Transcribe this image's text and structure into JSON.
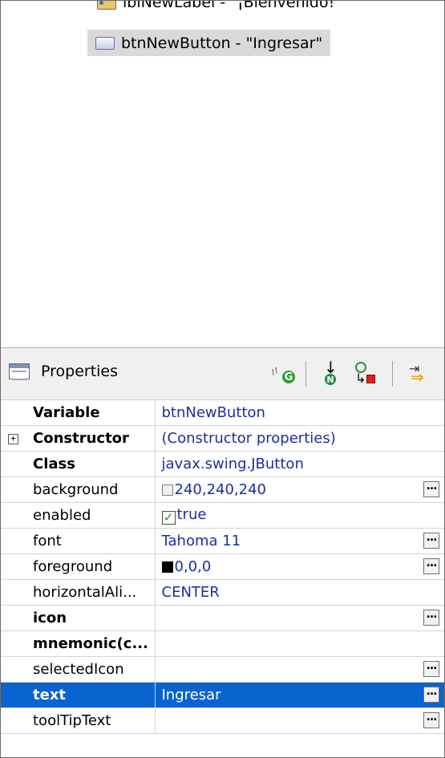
{
  "tree": {
    "items": [
      {
        "label": "lblNewLabel - \"¡Bienvenido!\"",
        "icon": "label-icon"
      },
      {
        "label": "btnNewButton - \"Ingresar\"",
        "icon": "button-icon",
        "selected": true
      }
    ]
  },
  "properties": {
    "title": "Properties",
    "toolbar": [
      "show-events-icon",
      "goto-definition-icon",
      "convert-local-to-field-icon",
      "export-icon"
    ],
    "rows": [
      {
        "name": "Variable",
        "value": "btnNewButton"
      },
      {
        "name": "Constructor",
        "value": "(Constructor properties)",
        "expander": "+"
      },
      {
        "name": "Class",
        "value": "javax.swing.JButton"
      },
      {
        "name": "background",
        "value": "240,240,240",
        "swatch": "#f0f0f0"
      },
      {
        "name": "enabled",
        "value": "true",
        "checkbox": "✓"
      },
      {
        "name": "font",
        "value": "Tahoma 11"
      },
      {
        "name": "foreground",
        "value": "0,0,0",
        "swatch": "#000000"
      },
      {
        "name": "horizontalAli...",
        "value": "CENTER"
      },
      {
        "name": "icon",
        "value": ""
      },
      {
        "name": "mnemonic(c...",
        "value": ""
      },
      {
        "name": "selectedIcon",
        "value": ""
      },
      {
        "name": "text",
        "value": "Ingresar"
      },
      {
        "name": "toolTipText",
        "value": ""
      }
    ],
    "ellipsis_label": "..."
  }
}
